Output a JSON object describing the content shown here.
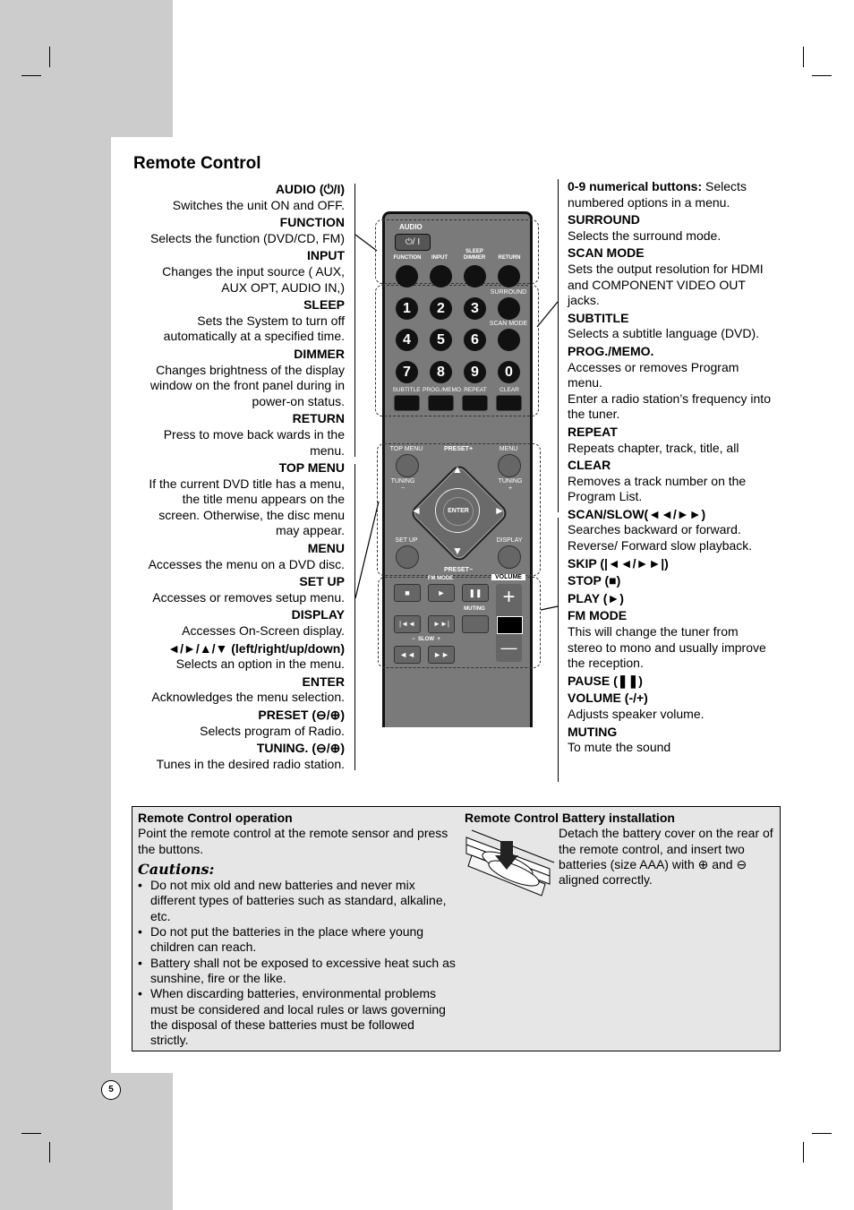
{
  "page": {
    "title": "Remote Control",
    "page_number": "5"
  },
  "left_entries": [
    {
      "heading": "AUDIO (⏻/I)",
      "desc": "Switches the unit ON and OFF."
    },
    {
      "heading": "FUNCTION",
      "desc": "Selects the function (DVD/CD, FM)"
    },
    {
      "heading": "INPUT",
      "desc": "Changes the input source ( AUX,\nAUX OPT, AUDIO IN,)"
    },
    {
      "heading": "SLEEP",
      "desc": "Sets the System to turn off\nautomatically at a specified time."
    },
    {
      "heading": "DIMMER",
      "desc": "Changes brightness of the display\nwindow on the front panel during in\npower-on status."
    },
    {
      "heading": "RETURN",
      "desc": "Press to move back wards in the\nmenu."
    },
    {
      "heading": "TOP MENU",
      "desc": "If the current DVD title has a menu,\nthe title menu appears on the\nscreen. Otherwise, the disc menu\nmay appear."
    },
    {
      "heading": "MENU",
      "desc": "Accesses the menu on a DVD disc."
    },
    {
      "heading": "SET UP",
      "desc": "Accesses or removes setup menu."
    },
    {
      "heading": "DISPLAY",
      "desc": "Accesses On-Screen display."
    },
    {
      "heading": "◄/►/▲/▼ (left/right/up/down)",
      "desc": "Selects an option in the menu."
    },
    {
      "heading": "ENTER",
      "desc": "Acknowledges the menu selection."
    },
    {
      "heading": "PRESET (⊖/⊕)",
      "desc": "Selects program of Radio."
    },
    {
      "heading": "TUNING. (⊖/⊕)",
      "desc": "Tunes in the desired radio station."
    }
  ],
  "right_entries": [
    {
      "heading": "0-9 numerical buttons:",
      "desc": "Selects numbered options in a menu.",
      "inline": true
    },
    {
      "heading": "SURROUND",
      "desc": "Selects the surround mode."
    },
    {
      "heading": "SCAN MODE",
      "desc": "Sets the output resolution for HDMI\nand COMPONENT VIDEO OUT\njacks."
    },
    {
      "heading": "SUBTITLE",
      "desc": "Selects a subtitle language (DVD)."
    },
    {
      "heading": "PROG./MEMO.",
      "desc": "Accesses or removes Program\nmenu.\nEnter a radio station’s frequency into\nthe tuner."
    },
    {
      "heading": "REPEAT",
      "desc": "Repeats chapter, track, title, all"
    },
    {
      "heading": "CLEAR",
      "desc": "Removes a track number on the\nProgram List."
    },
    {
      "heading": "SCAN/SLOW(◄◄/►►)",
      "desc": "Searches backward or forward.\nReverse/ Forward slow playback."
    },
    {
      "heading": "SKIP (|◄◄/►►|)",
      "desc": ""
    },
    {
      "heading": "STOP (■)",
      "desc": ""
    },
    {
      "heading": "PLAY (►)",
      "desc": ""
    },
    {
      "heading": "FM MODE",
      "desc": "This will change the tuner from\nstereo to mono and usually improve\nthe reception."
    },
    {
      "heading": "PAUSE (❚❚)",
      "desc": ""
    },
    {
      "heading": "VOLUME (-/+)",
      "desc": "Adjusts speaker volume."
    },
    {
      "heading": "MUTING",
      "desc": "To mute the sound"
    }
  ],
  "remote": {
    "audio": "AUDIO",
    "power": "⏻/ I",
    "function": "FUNCTION",
    "input": "INPUT",
    "sleep_dimmer": "SLEEP\nDIMMER",
    "return": "RETURN",
    "surround": "SURROUND",
    "scan_mode": "SCAN MODE",
    "numbers": [
      "1",
      "2",
      "3",
      "4",
      "5",
      "6",
      "7",
      "8",
      "9",
      "0"
    ],
    "subtitle": "SUBTITLE",
    "prog_memo": "PROG./MEMO.",
    "repeat": "REPEAT",
    "clear": "CLEAR",
    "top_menu": "TOP MENU",
    "preset_plus": "PRESET+",
    "menu": "MENU",
    "tuning_minus": "TUNING\n−",
    "tuning_plus": "TUNING\n+",
    "enter": "ENTER",
    "set_up": "SET UP",
    "display": "DISPLAY",
    "preset_minus": "PRESET−",
    "fm_mode": "FM MODE",
    "volume": "VOLUME",
    "stop": "■",
    "play": "►",
    "pause": "❚❚",
    "muting": "MUTING",
    "skip_back": "|◄◄",
    "skip_fwd": "►►|",
    "slow": "−  SLOW  +",
    "scan_back": "◄◄",
    "scan_fwd": "►►",
    "vol_plus": "+",
    "vol_minus": "—",
    "up": "▲",
    "down": "▼",
    "left": "◄",
    "right": "►"
  },
  "operation": {
    "title": "Remote Control operation",
    "text": "Point the remote control at the remote sensor and press the buttons.",
    "cautions_title": "Cautions:",
    "cautions": [
      "Do not mix old and new batteries and never mix different types of batteries such as standard, alkaline, etc.",
      "Do not put the batteries in the place where young children can reach.",
      "Battery shall not be exposed to excessive heat such as sunshine, fire or the like.",
      "When discarding batteries, environmental problems must be considered and local rules or laws governing the disposal of these batteries must be followed strictly."
    ]
  },
  "battery": {
    "title": "Remote Control Battery installation",
    "text": "Detach the battery cover on the rear of the remote control, and insert two batteries (size AAA) with ⊕ and ⊖ aligned correctly."
  }
}
